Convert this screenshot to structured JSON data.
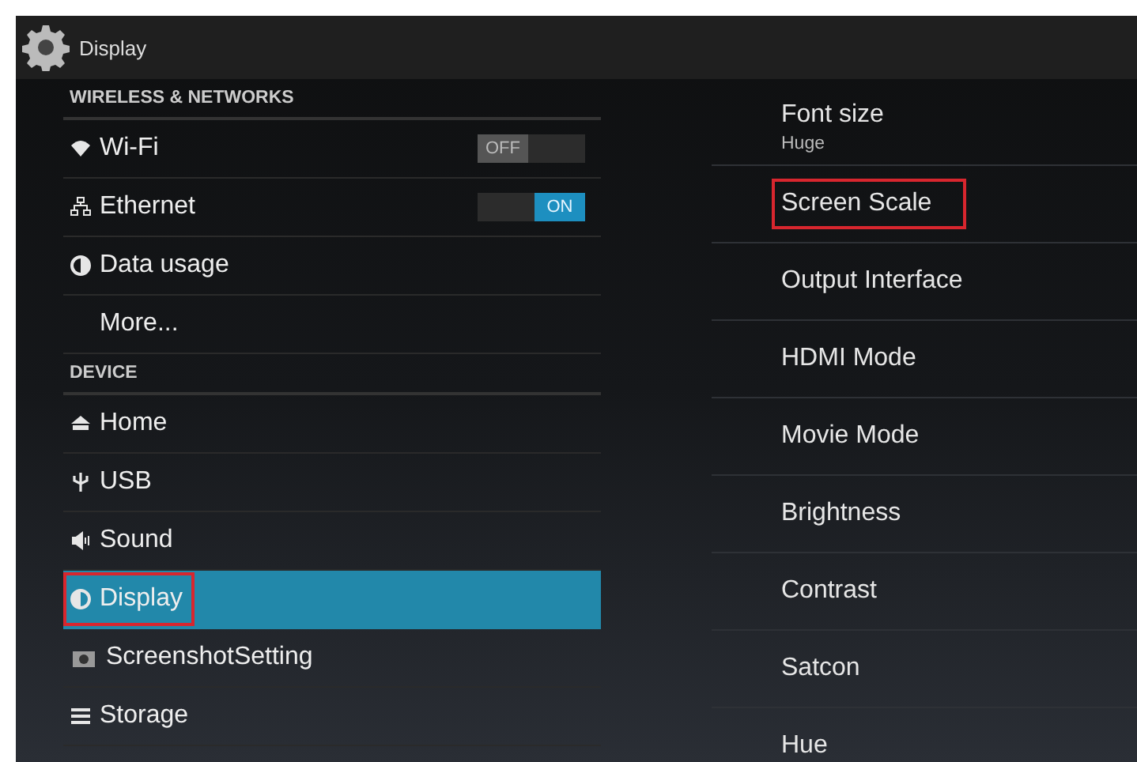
{
  "window": {
    "title": "Display"
  },
  "sidebar": {
    "sections": [
      {
        "header": "WIRELESS & NETWORKS",
        "items": [
          {
            "label": "Wi-Fi",
            "kind": "toggle",
            "on": false,
            "switch_text": "OFF",
            "selected": false,
            "annotated": false
          },
          {
            "label": "Ethernet",
            "kind": "toggle",
            "on": true,
            "switch_text": "ON",
            "selected": false,
            "annotated": false
          },
          {
            "label": "Data usage",
            "kind": "plain",
            "selected": false,
            "annotated": false
          },
          {
            "label": "More...",
            "kind": "plain",
            "selected": false,
            "annotated": false
          }
        ]
      },
      {
        "header": "DEVICE",
        "items": [
          {
            "label": "Home",
            "kind": "plain",
            "selected": false,
            "annotated": false
          },
          {
            "label": "USB",
            "kind": "plain",
            "selected": false,
            "annotated": false
          },
          {
            "label": "Sound",
            "kind": "plain",
            "selected": false,
            "annotated": false
          },
          {
            "label": "Display",
            "kind": "plain",
            "selected": true,
            "annotated": true
          },
          {
            "label": "ScreenshotSetting",
            "kind": "plain",
            "selected": false,
            "annotated": false
          },
          {
            "label": "Storage",
            "kind": "plain",
            "selected": false,
            "annotated": false
          }
        ]
      }
    ]
  },
  "settings": [
    {
      "title": "Font size",
      "summary": "Huge",
      "annotated": false
    },
    {
      "title": "Screen Scale",
      "annotated": true
    },
    {
      "title": "Output Interface",
      "annotated": false
    },
    {
      "title": "HDMI Mode",
      "annotated": false
    },
    {
      "title": "Movie Mode",
      "annotated": false
    },
    {
      "title": "Brightness",
      "annotated": false
    },
    {
      "title": "Contrast",
      "annotated": false
    },
    {
      "title": "Satcon",
      "annotated": false
    },
    {
      "title": "Hue",
      "annotated": false
    }
  ]
}
